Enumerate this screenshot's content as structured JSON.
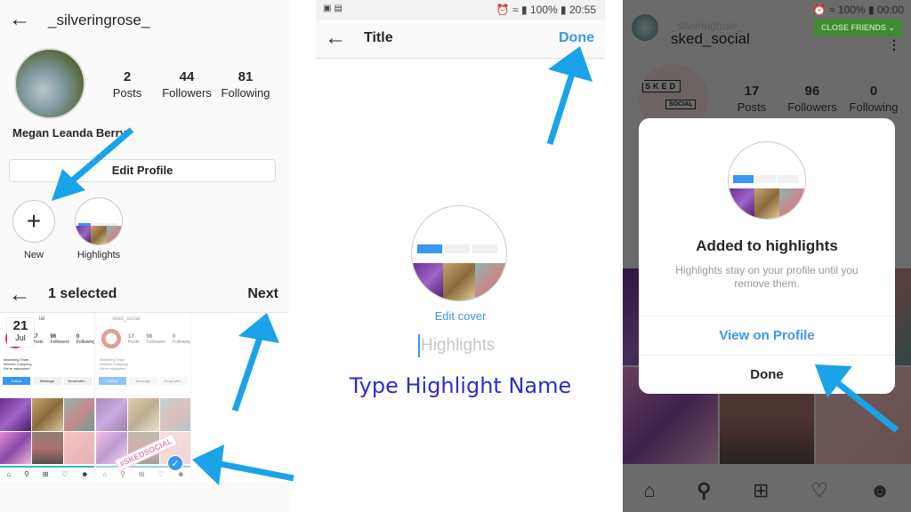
{
  "colors": {
    "accent": "#3897f0",
    "arrow": "#1aa3e8",
    "annotation": "#2d2dc8",
    "close_friends": "#3f8a33"
  },
  "panel1": {
    "header": {
      "back_icon": "arrow-left-icon",
      "username": "_silveringrose_"
    },
    "profile": {
      "full_name": "Megan Leanda Berry",
      "stats": [
        {
          "value": "2",
          "label": "Posts"
        },
        {
          "value": "44",
          "label": "Followers"
        },
        {
          "value": "81",
          "label": "Following"
        }
      ],
      "edit_profile_label": "Edit Profile"
    },
    "highlights": [
      {
        "label": "New",
        "icon": "plus-icon"
      },
      {
        "label": "Highlights"
      }
    ],
    "selection_bar": {
      "back_icon": "arrow-left-icon",
      "title": "1 selected",
      "next_label": "Next"
    },
    "story_thumbs": [
      {
        "date_day": "21",
        "date_month": "Jul",
        "header": "ial",
        "stats": [
          {
            "value": "17",
            "label": "Posts"
          },
          {
            "value": "96",
            "label": "Followers"
          },
          {
            "value": "0",
            "label": "Following"
          }
        ],
        "bio": [
          "Marketing Team",
          "Internet Company",
          "We're awesome!"
        ],
        "buttons": [
          "Follow",
          "Message",
          "Email with..."
        ]
      },
      {
        "header": "sked_social",
        "stats": [
          {
            "value": "17",
            "label": "Posts"
          },
          {
            "value": "96",
            "label": "Followers"
          },
          {
            "value": "0",
            "label": "Following"
          }
        ],
        "bio": [
          "Marketing Team",
          "Internet Company",
          "We're awesome!"
        ],
        "buttons": [
          "Follow",
          "Message",
          "Email with..."
        ],
        "tag": "#SKEDSOCIAL",
        "selected": true
      }
    ]
  },
  "panel2": {
    "status_bar": {
      "battery": "100%",
      "time": "20:55"
    },
    "header": {
      "back_icon": "arrow-left-icon",
      "title": "Title",
      "done_label": "Done"
    },
    "edit_cover_label": "Edit cover",
    "name_input": {
      "value": "",
      "placeholder": "Highlights"
    },
    "annotation": "Type Highlight Name"
  },
  "panel3": {
    "status_bar": {
      "battery": "100%",
      "time": "00:00"
    },
    "ghost_username": "_silveringrose_",
    "username": "sked_social",
    "close_friends_label": "CLOSE FRIENDS ⌄",
    "logo_text": "SKED",
    "logo_sub": "SOCIAL",
    "stats": [
      {
        "value": "17",
        "label": "Posts"
      },
      {
        "value": "96",
        "label": "Followers"
      },
      {
        "value": "0",
        "label": "Following"
      }
    ],
    "modal": {
      "title": "Added to highlights",
      "description": "Highlights stay on your profile until you remove them.",
      "view_label": "View on Profile",
      "done_label": "Done"
    },
    "nav": [
      "home-icon",
      "search-icon",
      "add-icon",
      "activity-icon",
      "profile-icon"
    ]
  }
}
